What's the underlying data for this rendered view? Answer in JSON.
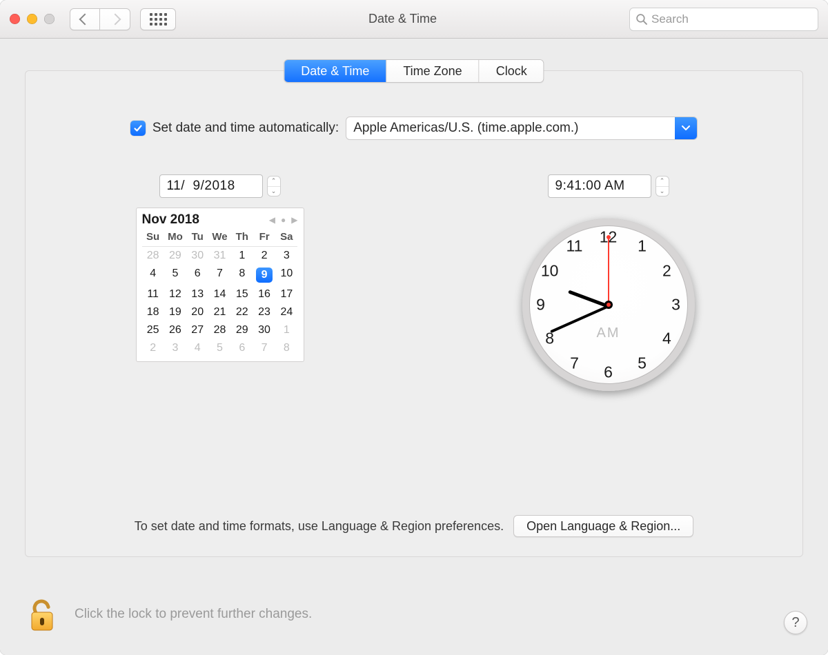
{
  "window": {
    "title": "Date & Time"
  },
  "search": {
    "placeholder": "Search"
  },
  "tabs": {
    "datetime": "Date & Time",
    "timezone": "Time Zone",
    "clock": "Clock"
  },
  "auto": {
    "checked": true,
    "label": "Set date and time automatically:",
    "server": "Apple Americas/U.S. (time.apple.com.)"
  },
  "date": {
    "field": "11/  9/2018"
  },
  "time": {
    "field": "9:41:00 AM",
    "ampm": "AM",
    "hour_angle": 200.5,
    "min_angle": 156,
    "sec_angle": -90
  },
  "calendar": {
    "title": "Nov 2018",
    "weekdays": [
      "Su",
      "Mo",
      "Tu",
      "We",
      "Th",
      "Fr",
      "Sa"
    ],
    "leading": [
      28,
      29,
      30,
      31
    ],
    "days": 30,
    "selected": 9,
    "trailing": [
      1,
      2,
      3,
      4,
      5,
      6,
      7,
      8
    ]
  },
  "clock_numbers": [
    "12",
    "1",
    "2",
    "3",
    "4",
    "5",
    "6",
    "7",
    "8",
    "9",
    "10",
    "11"
  ],
  "footer": {
    "hint": "To set date and time formats, use Language & Region preferences.",
    "open_button": "Open Language & Region..."
  },
  "lock": {
    "text": "Click the lock to prevent further changes."
  },
  "help": "?"
}
